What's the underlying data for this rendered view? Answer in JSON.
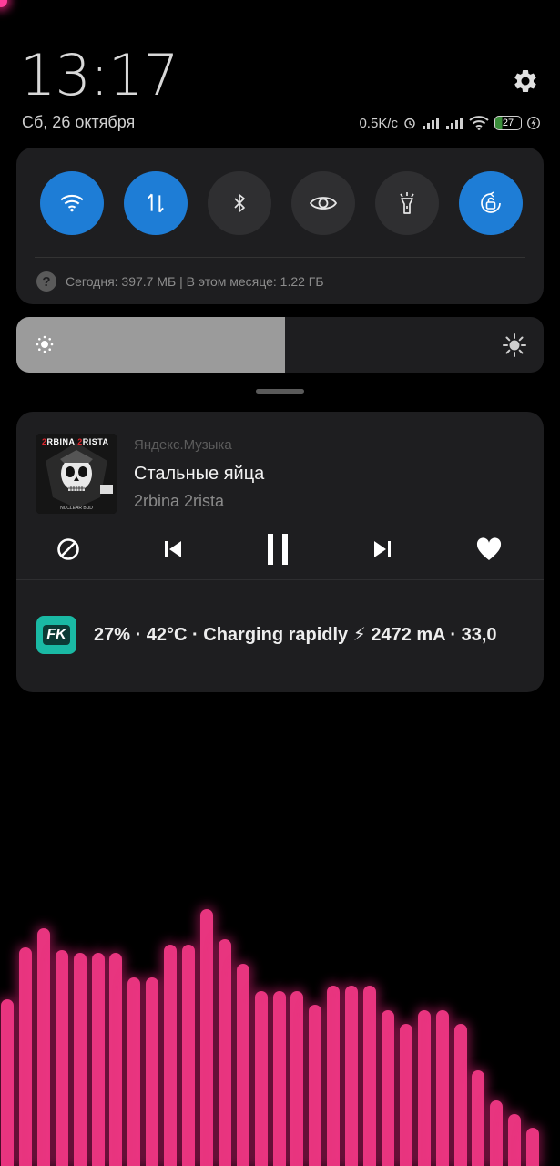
{
  "status_bar": {
    "time": "13:17",
    "date": "Сб, 26 октября",
    "network_speed": "0.5K/c",
    "battery_level": "27",
    "icons": [
      "alarm-icon",
      "signal-icon",
      "signal-icon",
      "wifi-icon",
      "battery-icon",
      "charging-icon"
    ]
  },
  "quick_settings": {
    "toggles": [
      {
        "name": "wifi",
        "icon": "wifi-icon",
        "on": true
      },
      {
        "name": "mobile-data",
        "icon": "data-arrows-icon",
        "on": true
      },
      {
        "name": "bluetooth",
        "icon": "bluetooth-icon",
        "on": false
      },
      {
        "name": "reading-mode",
        "icon": "eye-icon",
        "on": false
      },
      {
        "name": "flashlight",
        "icon": "flashlight-icon",
        "on": false
      },
      {
        "name": "auto-rotate",
        "icon": "rotation-lock-icon",
        "on": true
      }
    ],
    "data_usage": "Сегодня: 397.7 МБ | В этом месяце: 1.22 ГБ"
  },
  "brightness": {
    "level": 0.51
  },
  "media": {
    "app_name": "Яндекс.Музыка",
    "title": "Стальные яйца",
    "artist": "2rbina 2rista",
    "album_art_text": "2RBINA 2RISTA",
    "album_art_caption": "NUCLEAR BUD"
  },
  "battery_notification": {
    "app_icon_text": "FK",
    "text": "27% · 42°C · Charging rapidly ⚡ 2472 mA · 33,0"
  },
  "visualizer": {
    "color": "#e8357f",
    "levels": [
      0.61,
      0.8,
      0.87,
      0.79,
      0.78,
      0.78,
      0.78,
      0.69,
      0.69,
      0.81,
      0.81,
      0.94,
      0.83,
      0.74,
      0.64,
      0.64,
      0.64,
      0.59,
      0.66,
      0.66,
      0.66,
      0.57,
      0.52,
      0.57,
      0.57,
      0.52,
      0.35,
      0.24,
      0.19,
      0.14
    ]
  }
}
